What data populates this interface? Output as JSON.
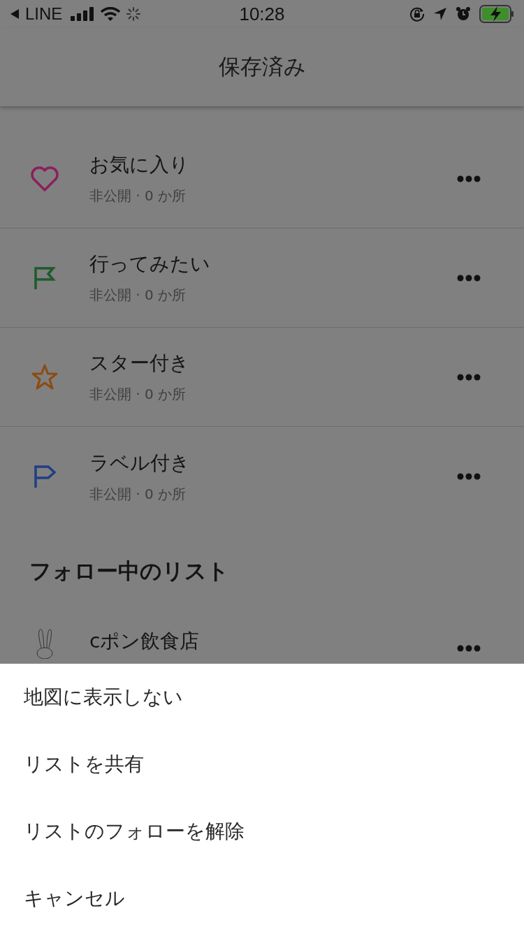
{
  "status_bar": {
    "carrier": "LINE",
    "time": "10:28"
  },
  "header": {
    "title": "保存済み"
  },
  "lists": [
    {
      "kind": "heart",
      "color": "#8c1f5c",
      "title": "お気に入り",
      "subtitle": "非公開 · 0 か所"
    },
    {
      "kind": "flag",
      "color": "#1f5a2c",
      "title": "行ってみたい",
      "subtitle": "非公開 · 0 か所"
    },
    {
      "kind": "star",
      "color": "#8a4c12",
      "title": "スター付き",
      "subtitle": "非公開 · 0 か所"
    },
    {
      "kind": "label",
      "color": "#213f82",
      "title": "ラベル付き",
      "subtitle": "非公開 · 0 か所"
    }
  ],
  "followed_section": {
    "heading": "フォロー中のリスト",
    "lists": [
      {
        "kind": "avatar",
        "title": "cポン飲食店"
      }
    ]
  },
  "action_sheet": {
    "items": [
      "地図に表示しない",
      "リストを共有",
      "リストのフォローを解除",
      "キャンセル"
    ]
  }
}
